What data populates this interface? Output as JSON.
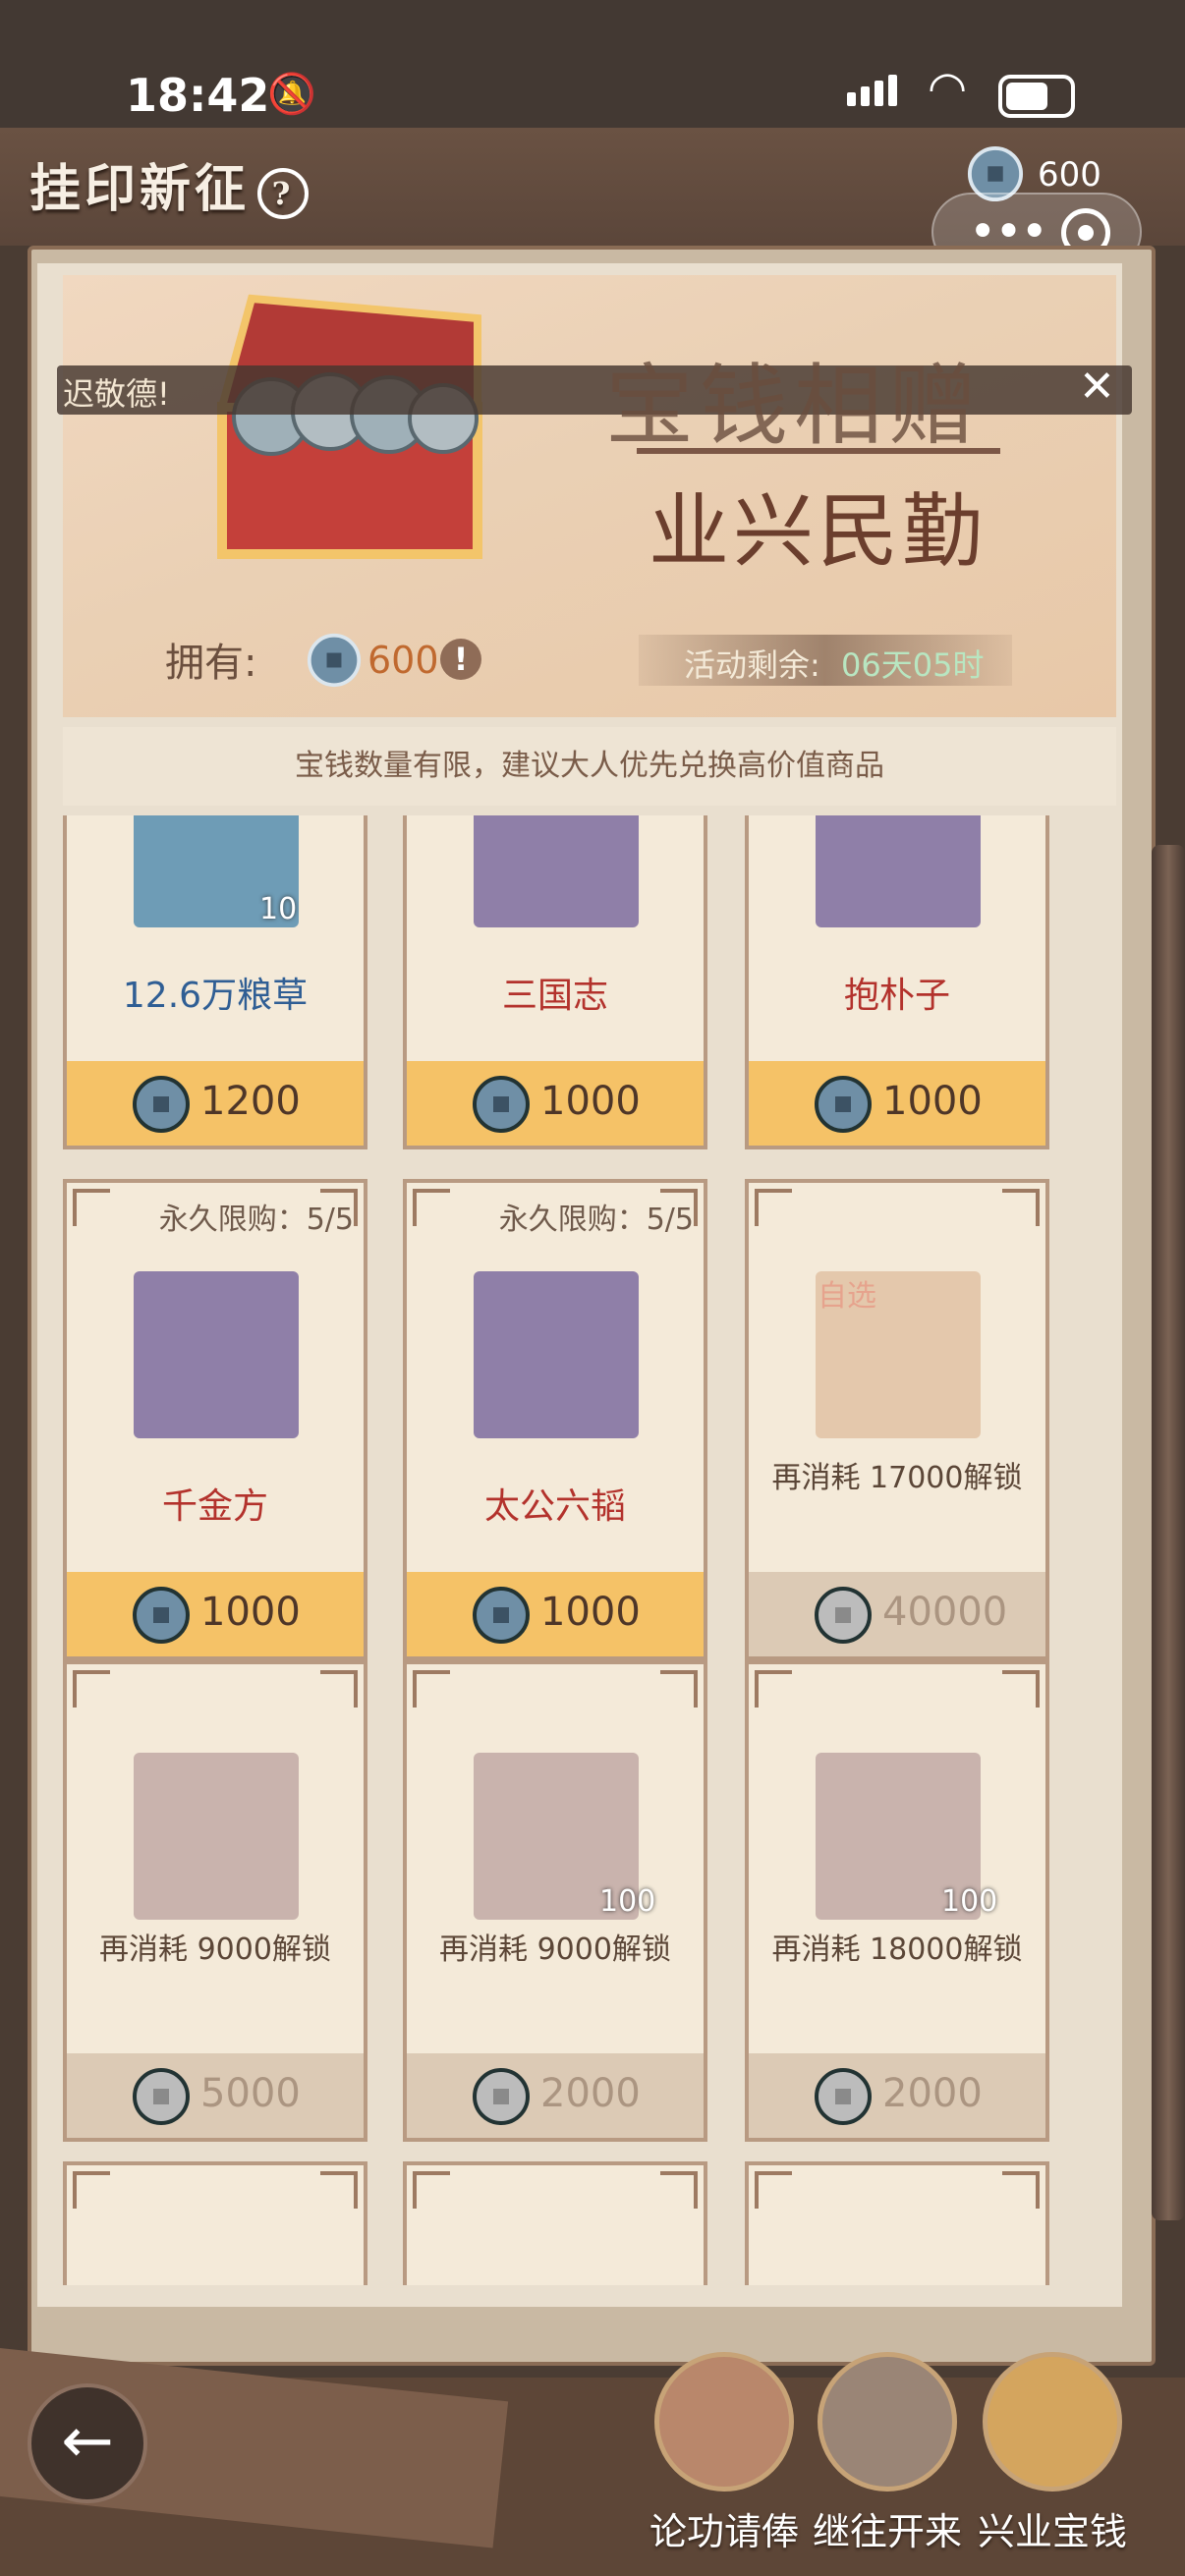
{
  "status": {
    "time": "18:42"
  },
  "header": {
    "title": "挂印新征",
    "help_icon": "?",
    "coin_count": "600"
  },
  "banner": {
    "ticker": "迟敬德!",
    "headline_main": "宝钱相赠",
    "headline_sub": "业兴民勤",
    "own_label": "拥有:",
    "own_value": "600",
    "warn": "!",
    "remaining_label": "活动剩余:",
    "remaining_value": "06天05时"
  },
  "notice": "宝钱数量有限，建议大人优先兑换高价值商品",
  "items": [
    {
      "name": "12.6万粮草",
      "price": "1200",
      "badge": "10",
      "limit": "",
      "unlock": "",
      "state": "buy",
      "name_color": "#2f5e94",
      "thumb": "#6e9cb6"
    },
    {
      "name": "三国志",
      "price": "1000",
      "badge": "",
      "limit": "",
      "unlock": "",
      "state": "buy",
      "name_color": "#b3322c",
      "thumb": "#8f7fa8"
    },
    {
      "name": "抱朴子",
      "price": "1000",
      "badge": "",
      "limit": "",
      "unlock": "",
      "state": "buy",
      "name_color": "#b3322c",
      "thumb": "#8f7fa8"
    },
    {
      "name": "千金方",
      "price": "1000",
      "badge": "",
      "limit": "永久限购：5/5",
      "unlock": "",
      "state": "buy",
      "name_color": "#b3322c",
      "thumb": "#8f7fa8"
    },
    {
      "name": "太公六韬",
      "price": "1000",
      "badge": "",
      "limit": "永久限购：5/5",
      "unlock": "",
      "state": "buy",
      "name_color": "#b3322c",
      "thumb": "#8f7fa8"
    },
    {
      "name": "",
      "price": "40000",
      "badge": "",
      "limit": "",
      "unlock": "再消耗 17000解锁",
      "state": "locked",
      "name_color": "#5b4637",
      "thumb": "#e4c8ac",
      "tag": "自选"
    },
    {
      "name": "",
      "price": "5000",
      "badge": "",
      "limit": "",
      "unlock": "再消耗 9000解锁",
      "state": "locked",
      "name_color": "#5b4637",
      "thumb": "#c9b3ad"
    },
    {
      "name": "",
      "price": "2000",
      "badge": "100",
      "limit": "",
      "unlock": "再消耗 9000解锁",
      "state": "locked",
      "name_color": "#5b4637",
      "thumb": "#c9b3ad"
    },
    {
      "name": "",
      "price": "2000",
      "badge": "100",
      "limit": "",
      "unlock": "再消耗 18000解锁",
      "state": "locked",
      "name_color": "#5b4637",
      "thumb": "#c9b3ad"
    }
  ],
  "bottom_nav": [
    {
      "label": "论功请俸",
      "icon": "scroll-medal-icon",
      "color": "#b9876b"
    },
    {
      "label": "继往开来",
      "icon": "gate-medal-icon",
      "color": "#9a8576"
    },
    {
      "label": "兴业宝钱",
      "icon": "coin-medal-icon",
      "color": "#d4a55e"
    }
  ],
  "colors": {
    "gold_price": "#f5c267",
    "locked_price": "#dccab5",
    "accent_red": "#b3322c"
  }
}
